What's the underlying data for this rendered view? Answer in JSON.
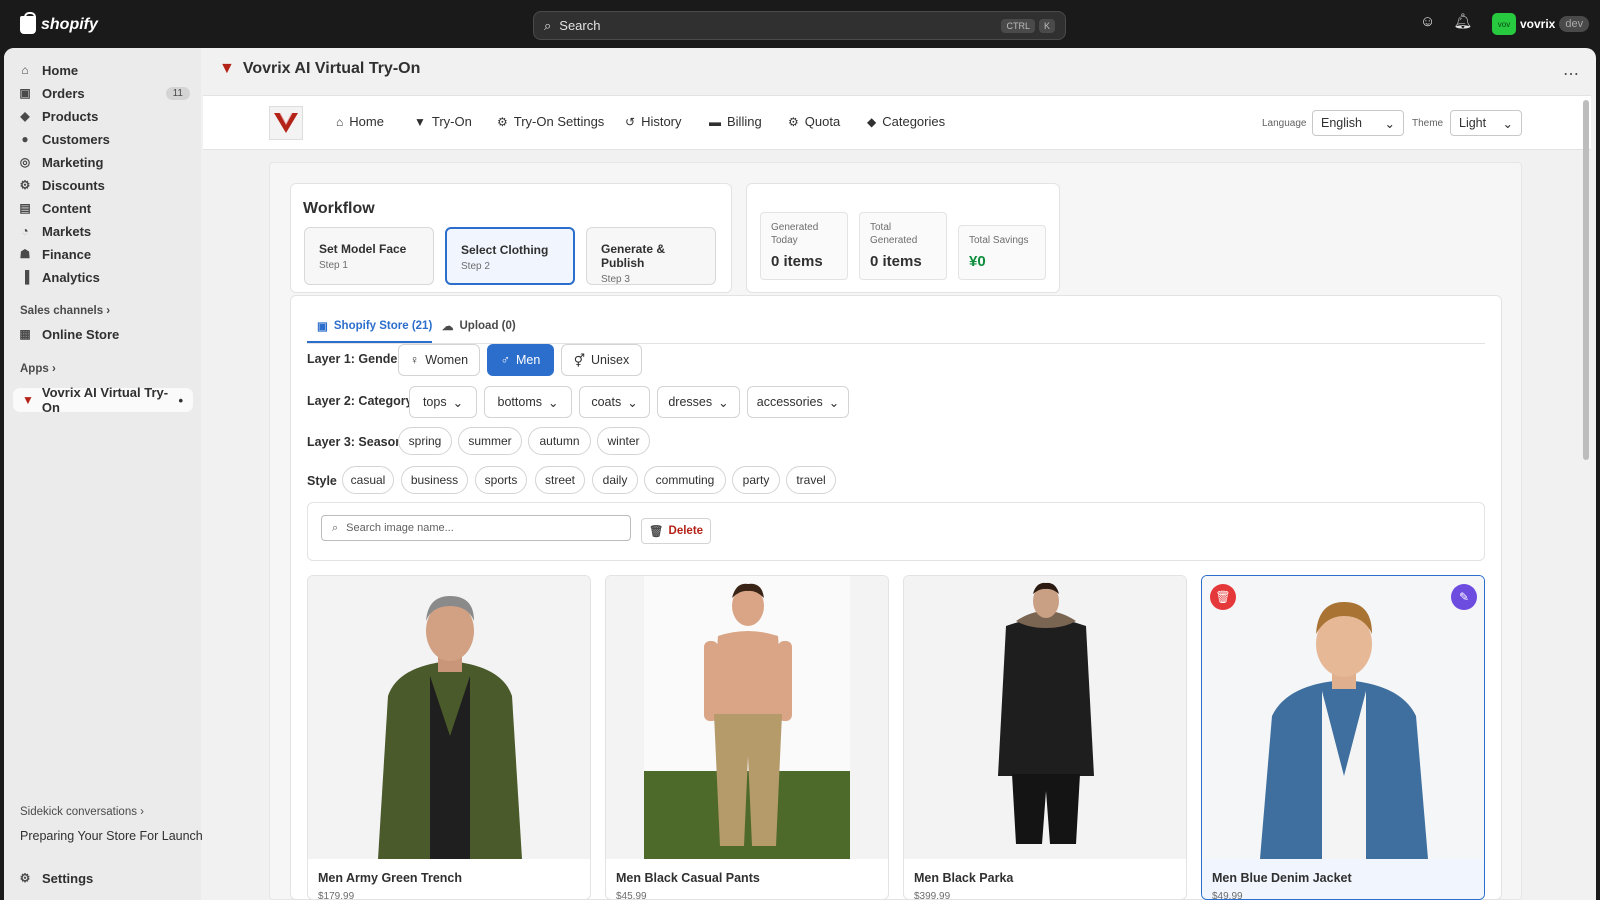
{
  "topbar": {
    "logo_text": "shopify",
    "search_placeholder": "Search",
    "kbd1": "CTRL",
    "kbd2": "K",
    "store_initials": "vov",
    "store_name": "vovrix",
    "store_badge": "dev"
  },
  "sidebar": {
    "items": [
      {
        "label": "Home",
        "icon": "home-icon"
      },
      {
        "label": "Orders",
        "icon": "inbox-icon",
        "badge": "11"
      },
      {
        "label": "Products",
        "icon": "tag-icon"
      },
      {
        "label": "Customers",
        "icon": "person-icon"
      },
      {
        "label": "Marketing",
        "icon": "target-icon"
      },
      {
        "label": "Discounts",
        "icon": "discount-icon"
      },
      {
        "label": "Content",
        "icon": "content-icon"
      },
      {
        "label": "Markets",
        "icon": "globe-icon"
      },
      {
        "label": "Finance",
        "icon": "bank-icon"
      },
      {
        "label": "Analytics",
        "icon": "bar-chart-icon"
      }
    ],
    "sales_channels": "Sales channels",
    "online_store": "Online Store",
    "apps": "Apps",
    "app_item": "Vovrix AI Virtual Try-On",
    "sidekick": "Sidekick conversations",
    "preparing": "Preparing Your Store For Launch",
    "settings": "Settings"
  },
  "app": {
    "title": "Vovrix AI Virtual Try-On",
    "nav": [
      "Home",
      "Try-On",
      "Try-On Settings",
      "History",
      "Billing",
      "Quota",
      "Categories"
    ],
    "language_label": "Language",
    "language_value": "English",
    "theme_label": "Theme",
    "theme_value": "Light"
  },
  "workflow": {
    "title": "Workflow",
    "steps": [
      {
        "title": "Set Model Face",
        "sub": "Step 1"
      },
      {
        "title": "Select Clothing",
        "sub": "Step 2"
      },
      {
        "title": "Generate & Publish",
        "sub": "Step 3"
      }
    ]
  },
  "stats": [
    {
      "label": "Generated Today",
      "value": "0 items"
    },
    {
      "label": "Total Generated",
      "value": "0 items"
    },
    {
      "label": "Total Savings",
      "value": "¥0"
    }
  ],
  "tabs": [
    "Shopify Store (21)",
    "Upload (0)"
  ],
  "filters": {
    "gender_label": "Layer 1: Gender",
    "genders": [
      "Women",
      "Men",
      "Unisex"
    ],
    "category_label": "Layer 2: Category",
    "categories": [
      "tops",
      "bottoms",
      "coats",
      "dresses",
      "accessories"
    ],
    "season_label": "Layer 3: Season",
    "seasons": [
      "spring",
      "summer",
      "autumn",
      "winter"
    ],
    "style_label": "Style",
    "styles": [
      "casual",
      "business",
      "sports",
      "street",
      "daily",
      "commuting",
      "party",
      "travel"
    ]
  },
  "search_placeholder": "Search image name...",
  "delete_label": "Delete",
  "products": [
    {
      "name": "Men Army Green Trench",
      "price": "$179.99"
    },
    {
      "name": "Men Black Casual Pants",
      "price": "$45.99"
    },
    {
      "name": "Men Black Parka",
      "price": "$399.99"
    },
    {
      "name": "Men Blue Denim Jacket",
      "price": "$49.99"
    }
  ]
}
